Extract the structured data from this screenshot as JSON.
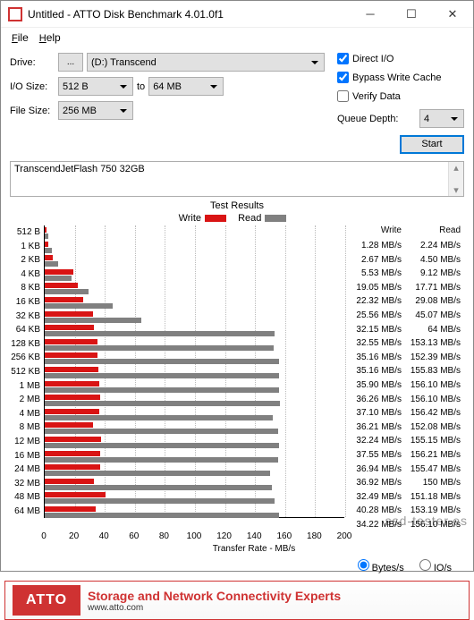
{
  "window": {
    "title": "Untitled - ATTO Disk Benchmark 4.01.0f1"
  },
  "menu": {
    "file": "File",
    "help": "Help"
  },
  "labels": {
    "drive": "Drive:",
    "iosize": "I/O Size:",
    "to": "to",
    "filesize": "File Size:",
    "direct_io": "Direct I/O",
    "bypass": "Bypass Write Cache",
    "verify": "Verify Data",
    "queue": "Queue Depth:",
    "start": "Start",
    "results": "Test Results",
    "write": "Write",
    "read": "Read",
    "xlabel": "Transfer Rate - MB/s",
    "bytes": "Bytes/s",
    "ios": "IO/s",
    "dots": "..."
  },
  "values": {
    "drive": "(D:) Transcend",
    "io_from": "512 B",
    "io_to": "64 MB",
    "filesize": "256 MB",
    "queue": "4",
    "device": "TranscendJetFlash 750 32GB"
  },
  "footer": {
    "brand": "ATTO",
    "big": "Storage and Network Connectivity Experts",
    "small": "www.atto.com"
  },
  "watermark": "ssd-tester.es",
  "xticks": [
    "0",
    "20",
    "40",
    "60",
    "80",
    "100",
    "120",
    "140",
    "160",
    "180",
    "200"
  ],
  "chart_data": {
    "type": "bar",
    "xlabel": "Transfer Rate - MB/s",
    "xlim": [
      0,
      200
    ],
    "categories": [
      "512 B",
      "1 KB",
      "2 KB",
      "4 KB",
      "8 KB",
      "16 KB",
      "32 KB",
      "64 KB",
      "128 KB",
      "256 KB",
      "512 KB",
      "1 MB",
      "2 MB",
      "4 MB",
      "8 MB",
      "12 MB",
      "16 MB",
      "24 MB",
      "32 MB",
      "48 MB",
      "64 MB"
    ],
    "series": [
      {
        "name": "Write",
        "color": "#d91414",
        "values": [
          1.28,
          2.67,
          5.53,
          19.05,
          22.32,
          25.56,
          32.15,
          32.55,
          35.16,
          35.16,
          35.9,
          36.26,
          37.1,
          36.21,
          32.24,
          37.55,
          36.94,
          36.92,
          32.49,
          40.28,
          34.22
        ]
      },
      {
        "name": "Read",
        "color": "#808080",
        "values": [
          2.24,
          4.5,
          9.12,
          17.71,
          29.08,
          45.07,
          64,
          153.13,
          152.39,
          155.83,
          156.1,
          156.1,
          156.42,
          152.08,
          155.15,
          156.21,
          155.47,
          150,
          151.18,
          153.19,
          156.1
        ]
      }
    ],
    "units": "MB/s"
  }
}
